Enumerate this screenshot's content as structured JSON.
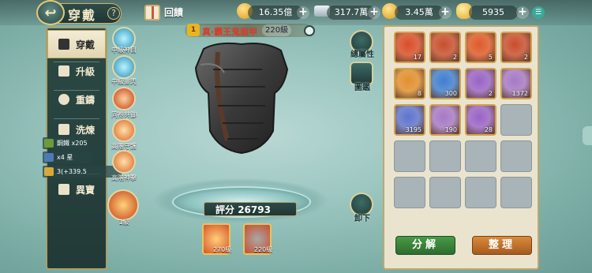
{
  "header": {
    "title": "穿戴",
    "help": "?",
    "topup_label": "回饋",
    "resources": [
      {
        "icon": "gold-coin-icon",
        "value": "16.35億",
        "color": "#e8b23a"
      },
      {
        "icon": "silver-ingot-icon",
        "value": "317.7萬",
        "color": "#c7d2d8"
      },
      {
        "icon": "gold-ingot-pile-icon",
        "value": "3.45萬",
        "color": "#f2c23b"
      },
      {
        "icon": "gold-yuanbao-icon",
        "value": "5935",
        "color": "#f4c63a"
      }
    ],
    "plus": "+"
  },
  "nav": {
    "items": [
      {
        "label": "穿戴",
        "icon": "sword-icon"
      },
      {
        "label": "升級",
        "icon": "arrow-up-icon"
      },
      {
        "label": "重鑄",
        "icon": "reforge-icon"
      },
      {
        "label": "洗煉",
        "icon": "anvil-icon"
      },
      {
        "label": "異寶",
        "icon": "anchor-icon"
      }
    ]
  },
  "skills": [
    {
      "label": "中級神目"
    },
    {
      "label": "中級靈閃"
    },
    {
      "label": "同袍共御"
    },
    {
      "label": "高階守護"
    },
    {
      "label": "高階神擊"
    },
    {
      "label": "1級"
    }
  ],
  "side_stats": [
    {
      "text": "鋼鐵 x205"
    },
    {
      "text": "x4 星"
    },
    {
      "text": "3(+339.5"
    }
  ],
  "item": {
    "star": "1",
    "name": "真·霸王鬼面甲",
    "level": "220級",
    "score_label": "評分",
    "score_value": "26793"
  },
  "right_buttons": [
    {
      "label": "總屬性",
      "icon": "attributes-icon"
    },
    {
      "label": "圖鑑",
      "icon": "book-icon"
    },
    {
      "label": "卸下",
      "icon": "arrow-down-icon"
    }
  ],
  "equipped": [
    {
      "label": "270級",
      "icon": "weapon-icon"
    },
    {
      "label": "220級",
      "icon": "armor-icon"
    }
  ],
  "inventory": {
    "items": [
      {
        "icon": "red-orb-item-icon",
        "qty": "17",
        "color": "#d94e2a"
      },
      {
        "icon": "dark-armor-item-icon",
        "qty": "2",
        "color": "#c94e2e"
      },
      {
        "icon": "gold-armor-item-icon",
        "qty": "5",
        "color": "#e05a2b"
      },
      {
        "icon": "dark-armor-item-icon",
        "qty": "2",
        "color": "#c94e2e"
      },
      {
        "icon": "orange-orb-item-icon",
        "qty": "8",
        "color": "#e3902f"
      },
      {
        "icon": "blue-orb-item-icon",
        "qty": "300",
        "color": "#3f7fd3"
      },
      {
        "icon": "purple-crystal-item-icon",
        "qty": "2",
        "color": "#9a63c9"
      },
      {
        "icon": "potion-item-icon",
        "qty": "1372",
        "color": "#a779c8"
      },
      {
        "icon": "blue-orb-item-icon",
        "qty": "3195",
        "color": "#5e74cf"
      },
      {
        "icon": "potion-item-icon",
        "qty": "190",
        "color": "#a779c8"
      },
      {
        "icon": "purple-crystal-item-icon",
        "qty": "28",
        "color": "#9a63c9"
      }
    ],
    "decompose_label": "分解",
    "sort_label": "整理"
  }
}
